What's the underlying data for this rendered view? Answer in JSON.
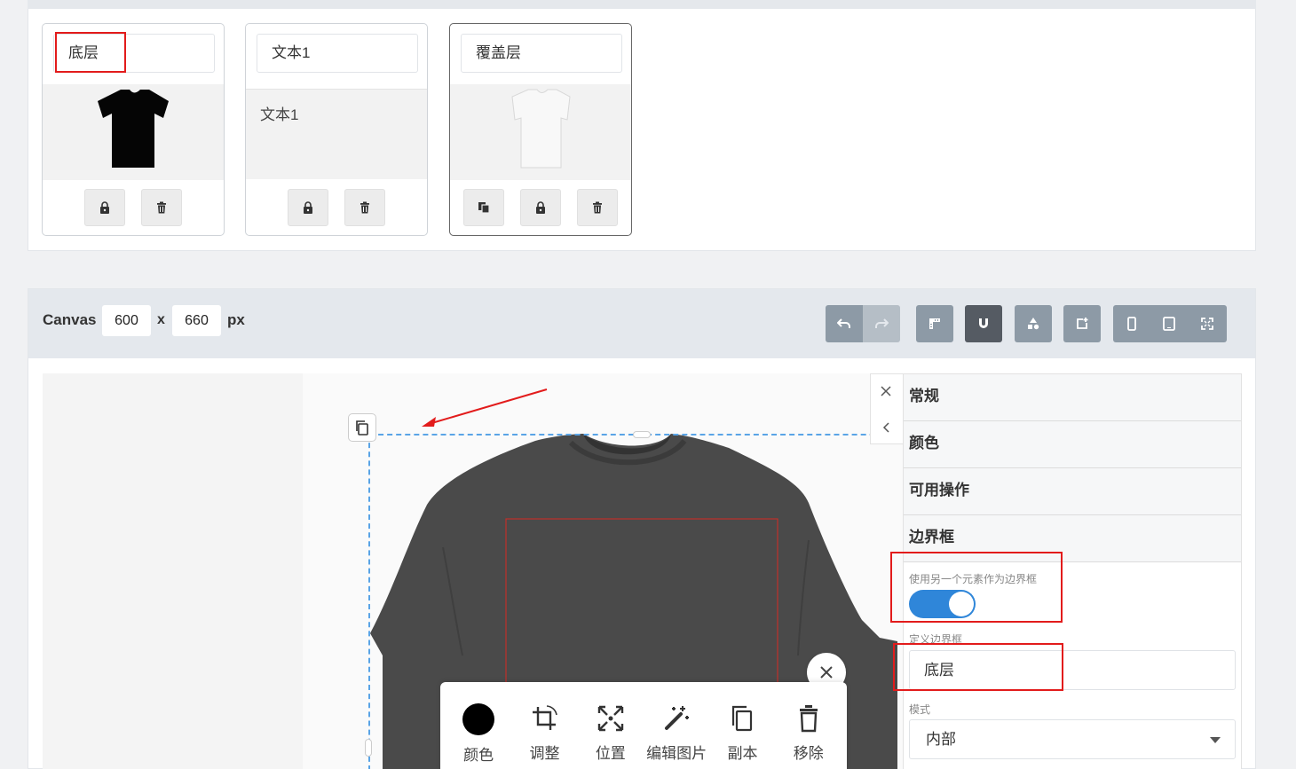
{
  "layers": [
    {
      "name": "底层",
      "preview_type": "black-tshirt"
    },
    {
      "name": "文本1",
      "preview_text": "文本1"
    },
    {
      "name": "覆盖层",
      "preview_type": "white-tshirt"
    }
  ],
  "canvas": {
    "label": "Canvas",
    "width": "600",
    "x_sep": "x",
    "height": "660",
    "unit": "px"
  },
  "toolbar_icons": [
    "undo-icon",
    "redo-icon",
    "ruler-icon",
    "magnet-icon",
    "shapes-icon",
    "add-canvas-icon",
    "phone-icon",
    "tablet-icon",
    "fullscreen-icon"
  ],
  "context_toolbar": {
    "color": "颜色",
    "adjust": "调整",
    "position": "位置",
    "edit_image": "编辑图片",
    "duplicate": "副本",
    "remove": "移除"
  },
  "properties": {
    "sections": [
      "常规",
      "颜色",
      "可用操作",
      "边界框"
    ],
    "use_other_element_label": "使用另一个元素作为边界框",
    "toggle_on": true,
    "define_bbox_label": "定义边界框",
    "define_bbox_value": "底层",
    "mode_label": "模式",
    "mode_value": "内部"
  },
  "colors": {
    "accent": "#2f86d9",
    "highlight": "#e21b1b",
    "bbox": "#5aa4e6",
    "toolbar_btn": "#8d9aa6",
    "shirt": "#4a4a4a"
  }
}
